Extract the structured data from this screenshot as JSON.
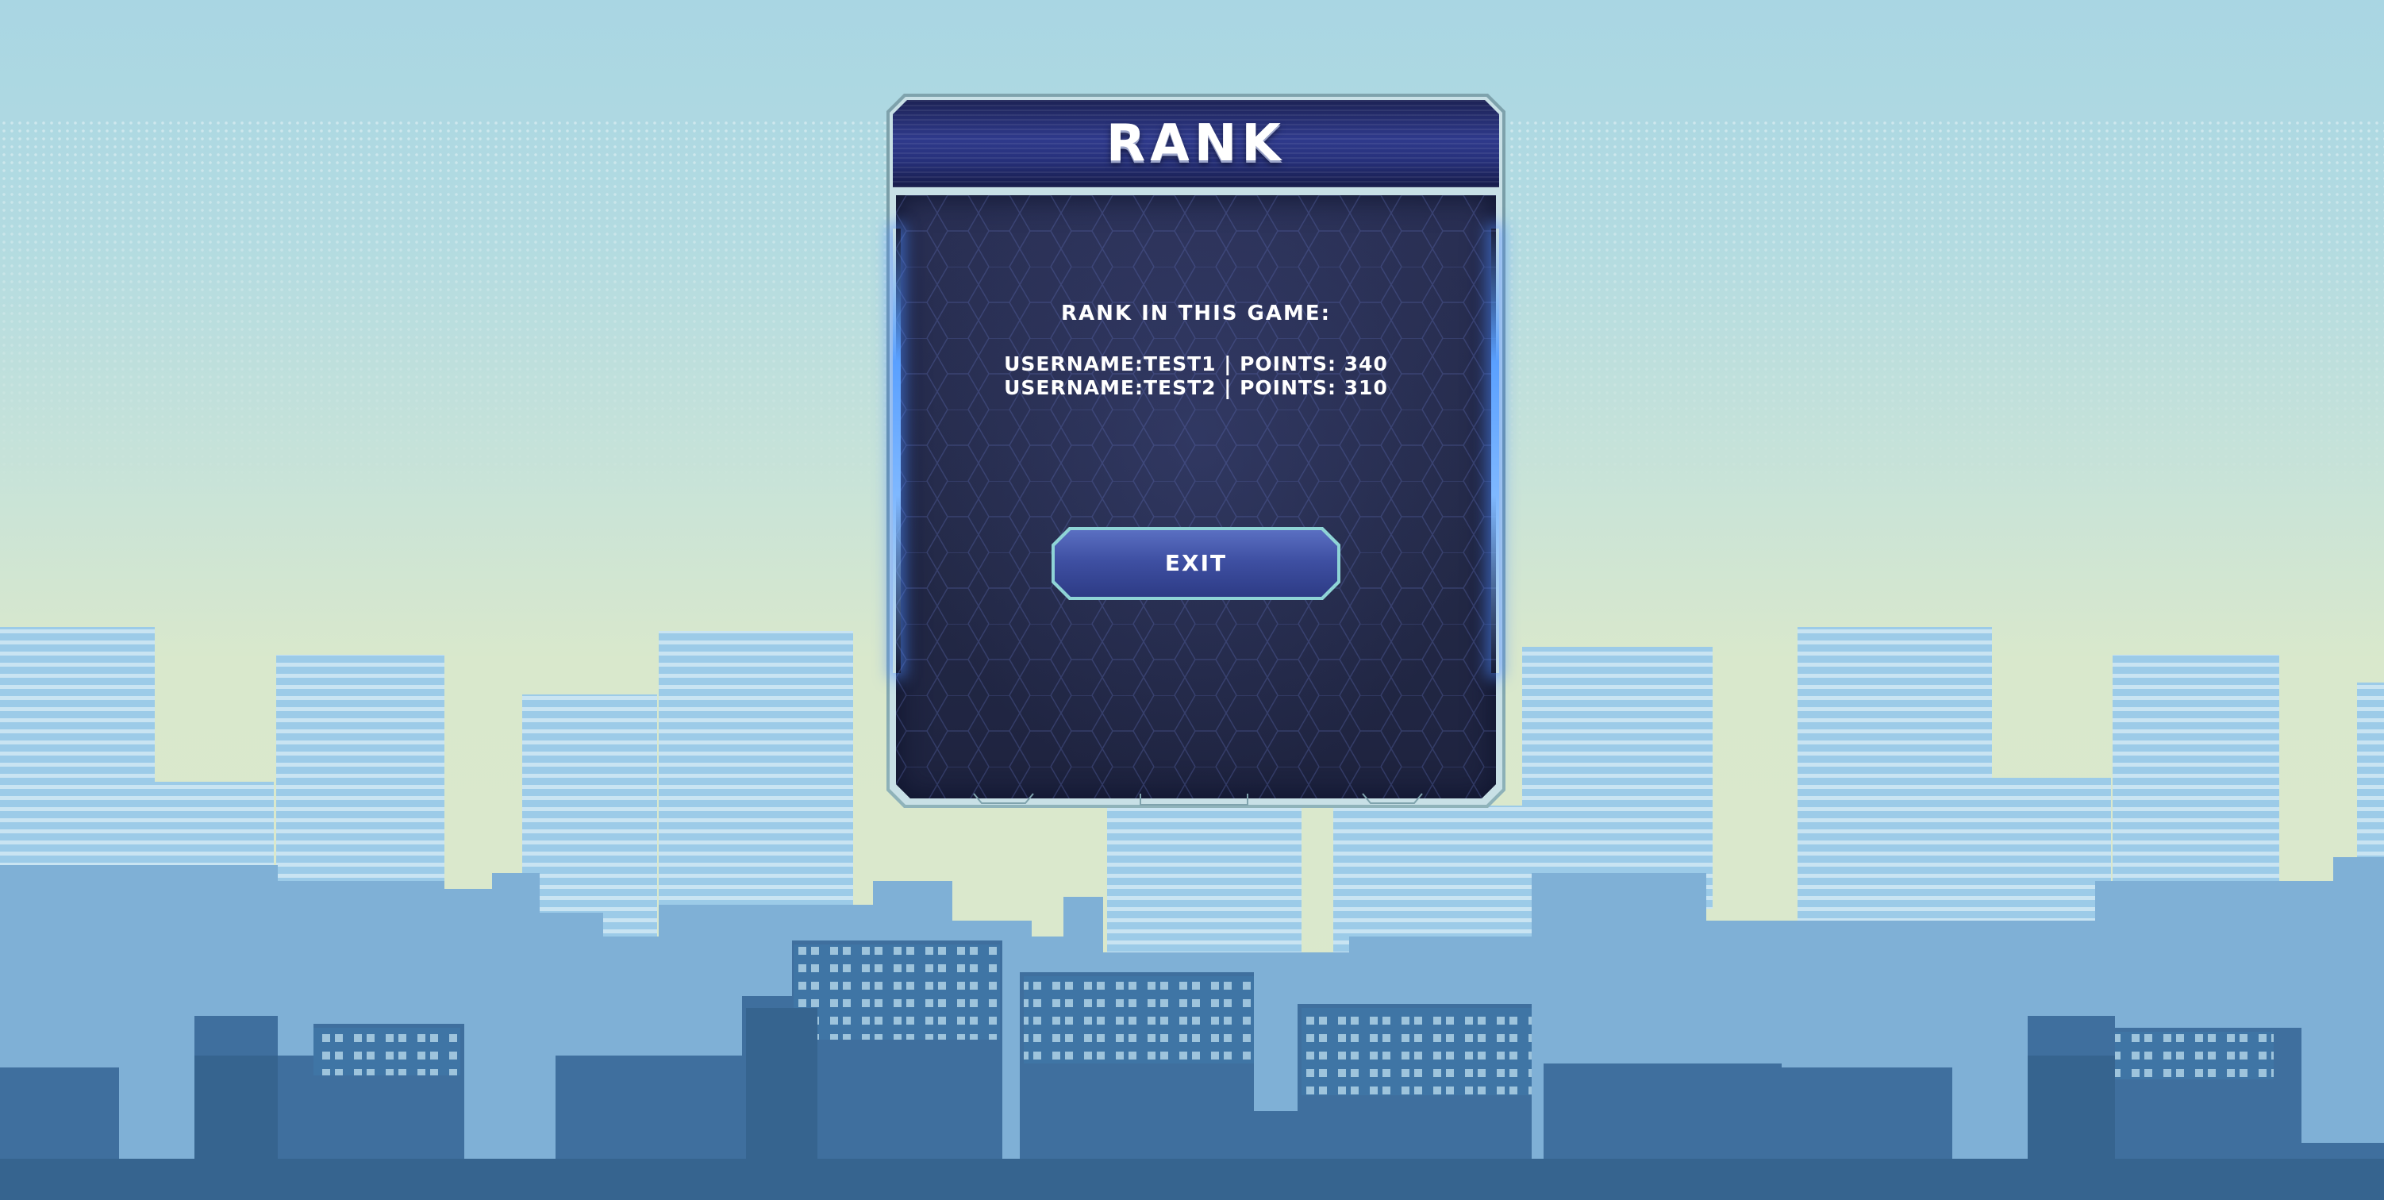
{
  "rank_panel": {
    "title": "RANK",
    "heading": "RANK IN THIS GAME:",
    "entries": [
      "USERNAME:TEST1 | POINTS: 340",
      "USERNAME:TEST2 | POINTS: 310"
    ],
    "exit_label": "EXIT"
  },
  "colors": {
    "panel_header": "#2f3a8c",
    "panel_body": "#262c4d",
    "button_fill": "#3f50a3",
    "button_border": "#8fd4d6",
    "sky": "#a9d6e3",
    "ground_haze": "#dbe9cb",
    "far_buildings": "#8bbedf",
    "near_buildings": "#3f76a6"
  }
}
